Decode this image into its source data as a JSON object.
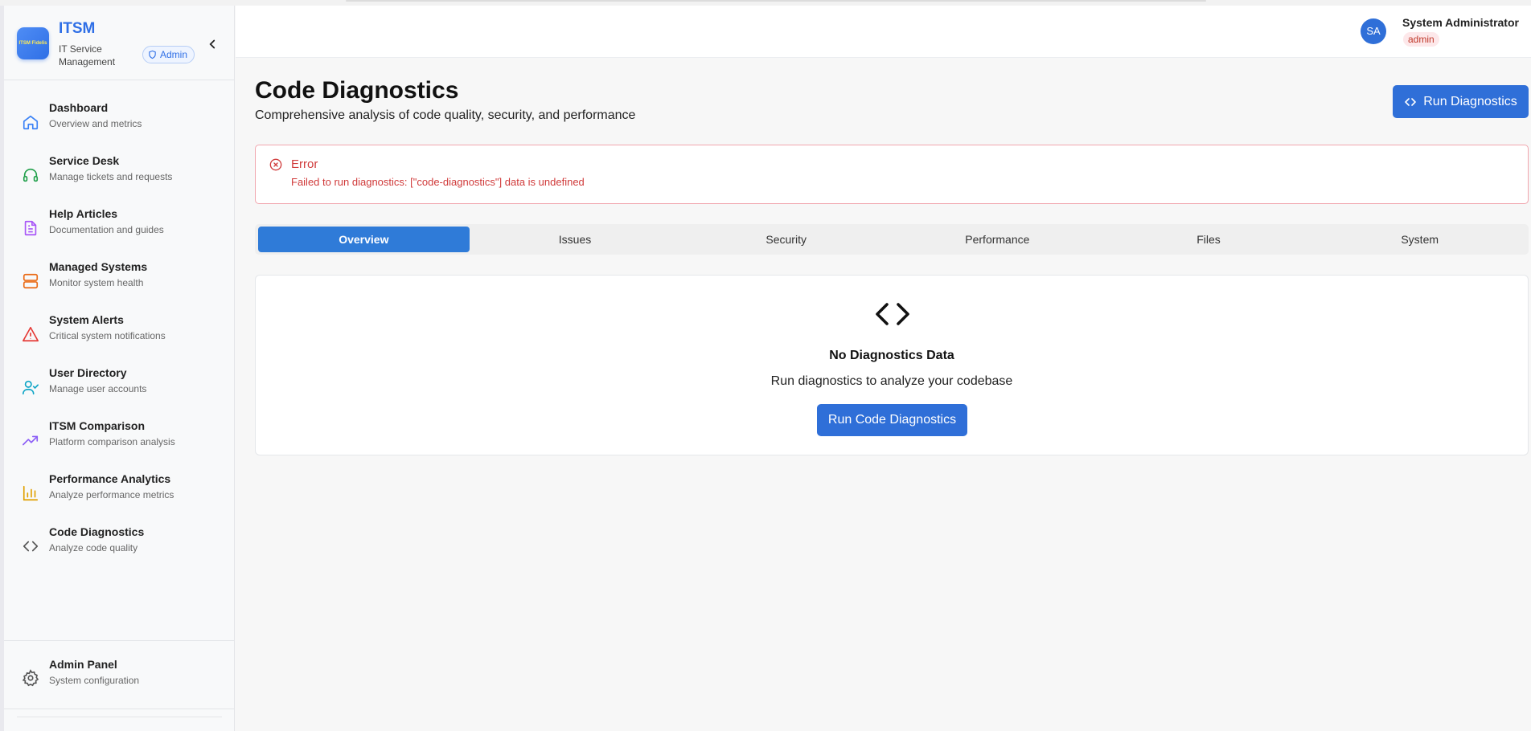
{
  "brand": {
    "logo_text": "ITSM Fidelis",
    "title": "ITSM",
    "subtitle": "IT Service Management",
    "role_badge": "Admin"
  },
  "sidebar": {
    "items": [
      {
        "label": "Dashboard",
        "desc": "Overview and metrics",
        "icon": "home-icon",
        "color": "#3b82f6"
      },
      {
        "label": "Service Desk",
        "desc": "Manage tickets and requests",
        "icon": "headset-icon",
        "color": "#22a04b"
      },
      {
        "label": "Help Articles",
        "desc": "Documentation and guides",
        "icon": "document-icon",
        "color": "#a855f7"
      },
      {
        "label": "Managed Systems",
        "desc": "Monitor system health",
        "icon": "server-icon",
        "color": "#ea6a14"
      },
      {
        "label": "System Alerts",
        "desc": "Critical system notifications",
        "icon": "warning-icon",
        "color": "#e53935"
      },
      {
        "label": "User Directory",
        "desc": "Manage user accounts",
        "icon": "user-check-icon",
        "color": "#0ea5c6"
      },
      {
        "label": "ITSM Comparison",
        "desc": "Platform comparison analysis",
        "icon": "trending-up-icon",
        "color": "#8b5cf6"
      },
      {
        "label": "Performance Analytics",
        "desc": "Analyze performance metrics",
        "icon": "bar-chart-icon",
        "color": "#e0a000"
      },
      {
        "label": "Code Diagnostics",
        "desc": "Analyze code quality",
        "icon": "code-icon",
        "color": "#555555"
      }
    ],
    "admin_panel": {
      "label": "Admin Panel",
      "desc": "System configuration",
      "icon": "gear-icon"
    }
  },
  "header": {
    "avatar_initials": "SA",
    "user_name": "System Administrator",
    "user_role": "admin"
  },
  "main": {
    "title": "Code Diagnostics",
    "subtitle": "Comprehensive analysis of code quality, security, and performance",
    "run_button": "Run Diagnostics",
    "error": {
      "title": "Error",
      "message": "Failed to run diagnostics: [\"code-diagnostics\"] data is undefined"
    },
    "tabs": [
      "Overview",
      "Issues",
      "Security",
      "Performance",
      "Files",
      "System"
    ],
    "active_tab": "Overview",
    "empty": {
      "title": "No Diagnostics Data",
      "subtitle": "Run diagnostics to analyze your codebase",
      "button": "Run Code Diagnostics"
    }
  },
  "colors": {
    "primary": "#2f6fd8",
    "error": "#d03a3a",
    "brand": "#2f6fe6"
  }
}
